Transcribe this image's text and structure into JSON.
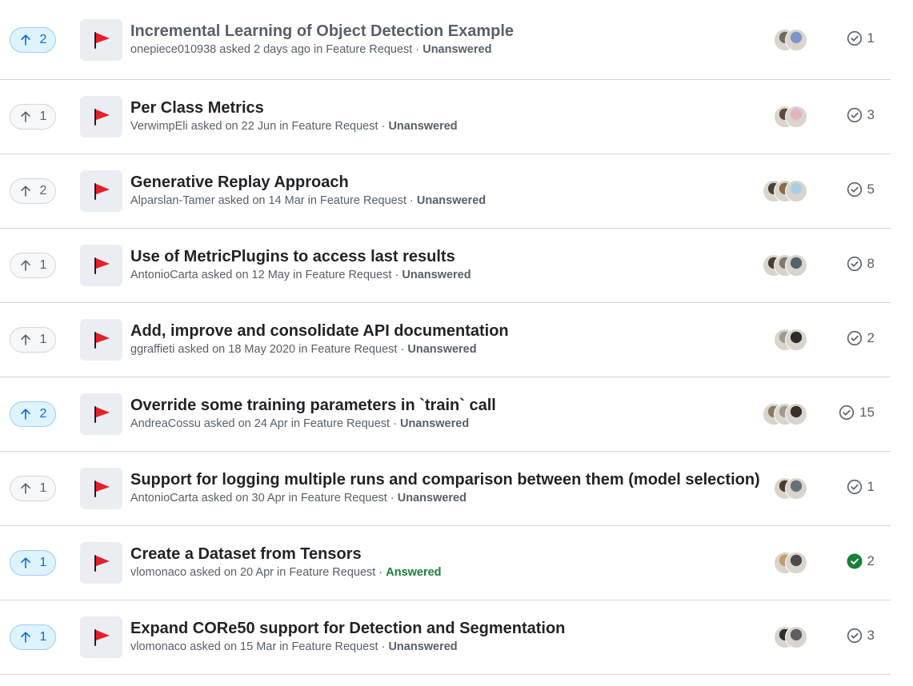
{
  "colors": {
    "accent": "#0969da",
    "answered": "#1a7f37",
    "muted": "#57606a",
    "flag": "#e5202a",
    "border": "#d0d7de"
  },
  "discussions": [
    {
      "votes": "2",
      "voted": true,
      "title": "Incremental Learning of Object Detection Example",
      "author": "onepiece010938",
      "asked": "asked 2 days ago in",
      "category": "Feature Request",
      "status": "Unanswered",
      "answered": false,
      "answers": "1",
      "avatars": [
        "#6b6a63",
        "#7d95c8"
      ],
      "category_icon": "red-flag-icon"
    },
    {
      "votes": "1",
      "voted": false,
      "title": "Per Class Metrics",
      "author": "VerwimpEli",
      "asked": "asked on 22 Jun in",
      "category": "Feature Request",
      "status": "Unanswered",
      "answered": false,
      "answers": "3",
      "avatars": [
        "#5a4a3e",
        "#e6b3c2"
      ],
      "category_icon": "red-flag-icon"
    },
    {
      "votes": "2",
      "voted": false,
      "title": "Generative Replay Approach",
      "author": "Alparslan-Tamer",
      "asked": "asked on 14 Mar in",
      "category": "Feature Request",
      "status": "Unanswered",
      "answered": false,
      "answers": "5",
      "avatars": [
        "#4b4237",
        "#8a6a4c",
        "#a9cde8"
      ],
      "category_icon": "red-flag-icon"
    },
    {
      "votes": "1",
      "voted": false,
      "title": "Use of MetricPlugins to access last results",
      "author": "AntonioCarta",
      "asked": "asked on 12 May in",
      "category": "Feature Request",
      "status": "Unanswered",
      "answered": false,
      "answers": "8",
      "avatars": [
        "#4a3d33",
        "#7e7a72",
        "#55626e"
      ],
      "category_icon": "red-flag-icon"
    },
    {
      "votes": "1",
      "voted": false,
      "title": "Add, improve and consolidate API documentation",
      "author": "ggraffieti",
      "asked": "asked on 18 May 2020 in",
      "category": "Feature Request",
      "status": "Unanswered",
      "answered": false,
      "answers": "2",
      "avatars": [
        "#9d9a93",
        "#2c2c2c"
      ],
      "category_icon": "red-flag-icon"
    },
    {
      "votes": "2",
      "voted": true,
      "title": "Override some training parameters in `train` call",
      "author": "AndreaCossu",
      "asked": "asked on 24 Apr in",
      "category": "Feature Request",
      "status": "Unanswered",
      "answered": false,
      "answers": "15",
      "avatars": [
        "#8b7a62",
        "#a29a8c",
        "#3b3029"
      ],
      "category_icon": "red-flag-icon"
    },
    {
      "votes": "1",
      "voted": false,
      "title": "Support for logging multiple runs and comparison between them (model selection)",
      "author": "AntonioCarta",
      "asked": "asked on 30 Apr in",
      "category": "Feature Request",
      "status": "Unanswered",
      "answered": false,
      "answers": "1",
      "avatars": [
        "#4a3d33",
        "#6a7078"
      ],
      "category_icon": "red-flag-icon"
    },
    {
      "votes": "1",
      "voted": true,
      "title": "Create a Dataset from Tensors",
      "author": "vlomonaco",
      "asked": "asked on 20 Apr in",
      "category": "Feature Request",
      "status": "Answered",
      "answered": true,
      "answers": "2",
      "avatars": [
        "#c09a72",
        "#4b4b4b"
      ],
      "category_icon": "red-flag-icon"
    },
    {
      "votes": "1",
      "voted": true,
      "title": "Expand CORe50 support for Detection and Segmentation",
      "author": "vlomonaco",
      "asked": "asked on 15 Mar in",
      "category": "Feature Request",
      "status": "Unanswered",
      "answered": false,
      "answers": "3",
      "avatars": [
        "#2f2f2f",
        "#5e5e5e"
      ],
      "category_icon": "red-flag-icon"
    }
  ]
}
